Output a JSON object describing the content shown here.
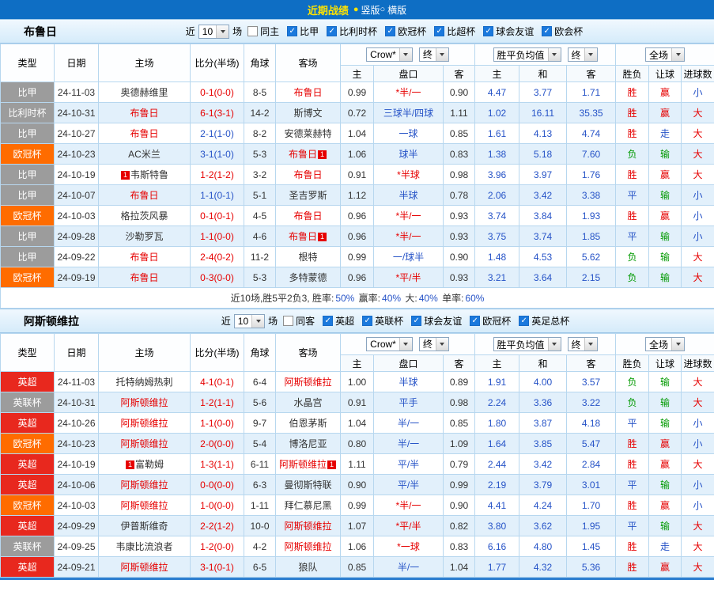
{
  "topbar": {
    "title": "近期战绩",
    "options": [
      {
        "label": "竖版",
        "selected": true
      },
      {
        "label": "横版",
        "selected": false
      }
    ]
  },
  "table_header": {
    "left_columns": [
      "类型",
      "日期",
      "主场",
      "比分(半场)",
      "角球",
      "客场"
    ],
    "group1_selects": [
      "Crow*",
      "终"
    ],
    "group2_selects": [
      "胜平负均值",
      "终"
    ],
    "group3_selects": [
      "全场"
    ],
    "sub_columns": [
      "主",
      "盘口",
      "客",
      "主",
      "和",
      "客",
      "胜负",
      "让球",
      "进球数"
    ]
  },
  "sections": [
    {
      "team": "布鲁日",
      "filter": {
        "near": "近",
        "count": "10",
        "games": "场",
        "same": "同主",
        "same_checked": false,
        "leagues": [
          {
            "label": "比甲",
            "checked": true
          },
          {
            "label": "比利时杯",
            "checked": true
          },
          {
            "label": "欧冠杯",
            "checked": true
          },
          {
            "label": "比超杯",
            "checked": true
          },
          {
            "label": "球会友谊",
            "checked": true
          },
          {
            "label": "欧会杯",
            "checked": true
          }
        ]
      },
      "rows": [
        {
          "type": "比甲",
          "type_style": "gray",
          "date": "24-11-03",
          "home": "奥德赫维里",
          "home_focus": false,
          "home_badge": false,
          "score": "0-1(0-0)",
          "score_color": "red",
          "corner": "8-5",
          "away": "布鲁日",
          "away_focus": true,
          "away_badge": false,
          "h_home": "0.99",
          "handicap": "*半/一",
          "handicap_color": "red",
          "h_away": "0.90",
          "e_home": "4.47",
          "e_draw": "3.77",
          "e_away": "1.71",
          "result": "胜",
          "result_color": "red",
          "cover": "赢",
          "cover_color": "red",
          "goals": "小",
          "goals_color": "blue"
        },
        {
          "type": "比利时杯",
          "type_style": "gray",
          "date": "24-10-31",
          "home": "布鲁日",
          "home_focus": true,
          "home_badge": false,
          "score": "6-1(3-1)",
          "score_color": "red",
          "corner": "14-2",
          "away": "斯博文",
          "away_focus": false,
          "away_badge": false,
          "h_home": "0.72",
          "handicap": "三球半/四球",
          "handicap_color": "blue",
          "h_away": "1.11",
          "e_home": "1.02",
          "e_draw": "16.11",
          "e_away": "35.35",
          "result": "胜",
          "result_color": "red",
          "cover": "赢",
          "cover_color": "red",
          "goals": "大",
          "goals_color": "red"
        },
        {
          "type": "比甲",
          "type_style": "gray",
          "date": "24-10-27",
          "home": "布鲁日",
          "home_focus": true,
          "home_badge": false,
          "score": "2-1(1-0)",
          "score_color": "blue",
          "corner": "8-2",
          "away": "安德莱赫特",
          "away_focus": false,
          "away_badge": false,
          "h_home": "1.04",
          "handicap": "一球",
          "handicap_color": "blue",
          "h_away": "0.85",
          "e_home": "1.61",
          "e_draw": "4.13",
          "e_away": "4.74",
          "result": "胜",
          "result_color": "red",
          "cover": "走",
          "cover_color": "blue",
          "goals": "大",
          "goals_color": "red"
        },
        {
          "type": "欧冠杯",
          "type_style": "orange",
          "date": "24-10-23",
          "home": "AC米兰",
          "home_focus": false,
          "home_badge": false,
          "score": "3-1(1-0)",
          "score_color": "blue",
          "corner": "5-3",
          "away": "布鲁日",
          "away_focus": true,
          "away_badge": true,
          "h_home": "1.06",
          "handicap": "球半",
          "handicap_color": "blue",
          "h_away": "0.83",
          "e_home": "1.38",
          "e_draw": "5.18",
          "e_away": "7.60",
          "result": "负",
          "result_color": "green",
          "cover": "输",
          "cover_color": "green",
          "goals": "大",
          "goals_color": "red"
        },
        {
          "type": "比甲",
          "type_style": "gray",
          "date": "24-10-19",
          "home": "韦斯特鲁",
          "home_focus": false,
          "home_badge": true,
          "score": "1-2(1-2)",
          "score_color": "red",
          "corner": "3-2",
          "away": "布鲁日",
          "away_focus": true,
          "away_badge": false,
          "h_home": "0.91",
          "handicap": "*半球",
          "handicap_color": "red",
          "h_away": "0.98",
          "e_home": "3.96",
          "e_draw": "3.97",
          "e_away": "1.76",
          "result": "胜",
          "result_color": "red",
          "cover": "赢",
          "cover_color": "red",
          "goals": "大",
          "goals_color": "red"
        },
        {
          "type": "比甲",
          "type_style": "gray",
          "date": "24-10-07",
          "home": "布鲁日",
          "home_focus": true,
          "home_badge": false,
          "score": "1-1(0-1)",
          "score_color": "blue",
          "corner": "5-1",
          "away": "圣吉罗斯",
          "away_focus": false,
          "away_badge": false,
          "h_home": "1.12",
          "handicap": "半球",
          "handicap_color": "blue",
          "h_away": "0.78",
          "e_home": "2.06",
          "e_draw": "3.42",
          "e_away": "3.38",
          "result": "平",
          "result_color": "blue",
          "cover": "输",
          "cover_color": "green",
          "goals": "小",
          "goals_color": "blue"
        },
        {
          "type": "欧冠杯",
          "type_style": "orange",
          "date": "24-10-03",
          "home": "格拉茨风暴",
          "home_focus": false,
          "home_badge": false,
          "score": "0-1(0-1)",
          "score_color": "red",
          "corner": "4-5",
          "away": "布鲁日",
          "away_focus": true,
          "away_badge": false,
          "h_home": "0.96",
          "handicap": "*半/一",
          "handicap_color": "red",
          "h_away": "0.93",
          "e_home": "3.74",
          "e_draw": "3.84",
          "e_away": "1.93",
          "result": "胜",
          "result_color": "red",
          "cover": "赢",
          "cover_color": "red",
          "goals": "小",
          "goals_color": "blue"
        },
        {
          "type": "比甲",
          "type_style": "gray",
          "date": "24-09-28",
          "home": "沙勒罗瓦",
          "home_focus": false,
          "home_badge": false,
          "score": "1-1(0-0)",
          "score_color": "red",
          "corner": "4-6",
          "away": "布鲁日",
          "away_focus": true,
          "away_badge": true,
          "h_home": "0.96",
          "handicap": "*半/一",
          "handicap_color": "red",
          "h_away": "0.93",
          "e_home": "3.75",
          "e_draw": "3.74",
          "e_away": "1.85",
          "result": "平",
          "result_color": "blue",
          "cover": "输",
          "cover_color": "green",
          "goals": "小",
          "goals_color": "blue"
        },
        {
          "type": "比甲",
          "type_style": "gray",
          "date": "24-09-22",
          "home": "布鲁日",
          "home_focus": true,
          "home_badge": false,
          "score": "2-4(0-2)",
          "score_color": "red",
          "corner": "11-2",
          "away": "根特",
          "away_focus": false,
          "away_badge": false,
          "h_home": "0.99",
          "handicap": "一/球半",
          "handicap_color": "blue",
          "h_away": "0.90",
          "e_home": "1.48",
          "e_draw": "4.53",
          "e_away": "5.62",
          "result": "负",
          "result_color": "green",
          "cover": "输",
          "cover_color": "green",
          "goals": "大",
          "goals_color": "red"
        },
        {
          "type": "欧冠杯",
          "type_style": "orange",
          "date": "24-09-19",
          "home": "布鲁日",
          "home_focus": true,
          "home_badge": false,
          "score": "0-3(0-0)",
          "score_color": "red",
          "corner": "5-3",
          "away": "多特蒙德",
          "away_focus": false,
          "away_badge": false,
          "h_home": "0.96",
          "handicap": "*平/半",
          "handicap_color": "red",
          "h_away": "0.93",
          "e_home": "3.21",
          "e_draw": "3.64",
          "e_away": "2.15",
          "result": "负",
          "result_color": "green",
          "cover": "输",
          "cover_color": "green",
          "goals": "大",
          "goals_color": "red"
        }
      ],
      "summary": [
        {
          "text": "近10场,胜5平2负3, 胜率:",
          "color": "black"
        },
        {
          "text": "50%",
          "color": "blue"
        },
        {
          "text": " 赢率:",
          "color": "black"
        },
        {
          "text": "40%",
          "color": "blue"
        },
        {
          "text": " 大:",
          "color": "black"
        },
        {
          "text": "40%",
          "color": "blue"
        },
        {
          "text": " 单率:",
          "color": "black"
        },
        {
          "text": "60%",
          "color": "blue"
        }
      ]
    },
    {
      "team": "阿斯顿维拉",
      "filter": {
        "near": "近",
        "count": "10",
        "games": "场",
        "same": "同客",
        "same_checked": false,
        "leagues": [
          {
            "label": "英超",
            "checked": true
          },
          {
            "label": "英联杯",
            "checked": true
          },
          {
            "label": "球会友谊",
            "checked": true
          },
          {
            "label": "欧冠杯",
            "checked": true
          },
          {
            "label": "英足总杯",
            "checked": true
          }
        ]
      },
      "rows": [
        {
          "type": "英超",
          "type_style": "red",
          "date": "24-11-03",
          "home": "托特纳姆热刺",
          "home_focus": false,
          "home_badge": false,
          "score": "4-1(0-1)",
          "score_color": "red",
          "corner": "6-4",
          "away": "阿斯顿维拉",
          "away_focus": true,
          "away_badge": false,
          "h_home": "1.00",
          "handicap": "半球",
          "handicap_color": "blue",
          "h_away": "0.89",
          "e_home": "1.91",
          "e_draw": "4.00",
          "e_away": "3.57",
          "result": "负",
          "result_color": "green",
          "cover": "输",
          "cover_color": "green",
          "goals": "大",
          "goals_color": "red"
        },
        {
          "type": "英联杯",
          "type_style": "gray",
          "date": "24-10-31",
          "home": "阿斯顿维拉",
          "home_focus": true,
          "home_badge": false,
          "score": "1-2(1-1)",
          "score_color": "red",
          "corner": "5-6",
          "away": "水晶宫",
          "away_focus": false,
          "away_badge": false,
          "h_home": "0.91",
          "handicap": "平手",
          "handicap_color": "blue",
          "h_away": "0.98",
          "e_home": "2.24",
          "e_draw": "3.36",
          "e_away": "3.22",
          "result": "负",
          "result_color": "green",
          "cover": "输",
          "cover_color": "green",
          "goals": "大",
          "goals_color": "red"
        },
        {
          "type": "英超",
          "type_style": "red",
          "date": "24-10-26",
          "home": "阿斯顿维拉",
          "home_focus": true,
          "home_badge": false,
          "score": "1-1(0-0)",
          "score_color": "red",
          "corner": "9-7",
          "away": "伯恩茅斯",
          "away_focus": false,
          "away_badge": false,
          "h_home": "1.04",
          "handicap": "半/一",
          "handicap_color": "blue",
          "h_away": "0.85",
          "e_home": "1.80",
          "e_draw": "3.87",
          "e_away": "4.18",
          "result": "平",
          "result_color": "blue",
          "cover": "输",
          "cover_color": "green",
          "goals": "小",
          "goals_color": "blue"
        },
        {
          "type": "欧冠杯",
          "type_style": "orange",
          "date": "24-10-23",
          "home": "阿斯顿维拉",
          "home_focus": true,
          "home_badge": false,
          "score": "2-0(0-0)",
          "score_color": "red",
          "corner": "5-4",
          "away": "博洛尼亚",
          "away_focus": false,
          "away_badge": false,
          "h_home": "0.80",
          "handicap": "半/一",
          "handicap_color": "blue",
          "h_away": "1.09",
          "e_home": "1.64",
          "e_draw": "3.85",
          "e_away": "5.47",
          "result": "胜",
          "result_color": "red",
          "cover": "赢",
          "cover_color": "red",
          "goals": "小",
          "goals_color": "blue"
        },
        {
          "type": "英超",
          "type_style": "red",
          "date": "24-10-19",
          "home": "富勒姆",
          "home_focus": false,
          "home_badge": true,
          "score": "1-3(1-1)",
          "score_color": "red",
          "corner": "6-11",
          "away": "阿斯顿维拉",
          "away_focus": true,
          "away_badge": true,
          "h_home": "1.11",
          "handicap": "平/半",
          "handicap_color": "blue",
          "h_away": "0.79",
          "e_home": "2.44",
          "e_draw": "3.42",
          "e_away": "2.84",
          "result": "胜",
          "result_color": "red",
          "cover": "赢",
          "cover_color": "red",
          "goals": "大",
          "goals_color": "red"
        },
        {
          "type": "英超",
          "type_style": "red",
          "date": "24-10-06",
          "home": "阿斯顿维拉",
          "home_focus": true,
          "home_badge": false,
          "score": "0-0(0-0)",
          "score_color": "red",
          "corner": "6-3",
          "away": "曼彻斯特联",
          "away_focus": false,
          "away_badge": false,
          "h_home": "0.90",
          "handicap": "平/半",
          "handicap_color": "blue",
          "h_away": "0.99",
          "e_home": "2.19",
          "e_draw": "3.79",
          "e_away": "3.01",
          "result": "平",
          "result_color": "blue",
          "cover": "输",
          "cover_color": "green",
          "goals": "小",
          "goals_color": "blue"
        },
        {
          "type": "欧冠杯",
          "type_style": "orange",
          "date": "24-10-03",
          "home": "阿斯顿维拉",
          "home_focus": true,
          "home_badge": false,
          "score": "1-0(0-0)",
          "score_color": "red",
          "corner": "1-11",
          "away": "拜仁慕尼黑",
          "away_focus": false,
          "away_badge": false,
          "h_home": "0.99",
          "handicap": "*半/一",
          "handicap_color": "red",
          "h_away": "0.90",
          "e_home": "4.41",
          "e_draw": "4.24",
          "e_away": "1.70",
          "result": "胜",
          "result_color": "red",
          "cover": "赢",
          "cover_color": "red",
          "goals": "小",
          "goals_color": "blue"
        },
        {
          "type": "英超",
          "type_style": "red",
          "date": "24-09-29",
          "home": "伊普斯维奇",
          "home_focus": false,
          "home_badge": false,
          "score": "2-2(1-2)",
          "score_color": "red",
          "corner": "10-0",
          "away": "阿斯顿维拉",
          "away_focus": true,
          "away_badge": false,
          "h_home": "1.07",
          "handicap": "*平/半",
          "handicap_color": "red",
          "h_away": "0.82",
          "e_home": "3.80",
          "e_draw": "3.62",
          "e_away": "1.95",
          "result": "平",
          "result_color": "blue",
          "cover": "输",
          "cover_color": "green",
          "goals": "大",
          "goals_color": "red"
        },
        {
          "type": "英联杯",
          "type_style": "gray",
          "date": "24-09-25",
          "home": "韦康比流浪者",
          "home_focus": false,
          "home_badge": false,
          "score": "1-2(0-0)",
          "score_color": "red",
          "corner": "4-2",
          "away": "阿斯顿维拉",
          "away_focus": true,
          "away_badge": false,
          "h_home": "1.06",
          "handicap": "*一球",
          "handicap_color": "red",
          "h_away": "0.83",
          "e_home": "6.16",
          "e_draw": "4.80",
          "e_away": "1.45",
          "result": "胜",
          "result_color": "red",
          "cover": "走",
          "cover_color": "blue",
          "goals": "大",
          "goals_color": "red"
        },
        {
          "type": "英超",
          "type_style": "red",
          "date": "24-09-21",
          "home": "阿斯顿维拉",
          "home_focus": true,
          "home_badge": false,
          "score": "3-1(0-1)",
          "score_color": "red",
          "corner": "6-5",
          "away": "狼队",
          "away_focus": false,
          "away_badge": false,
          "h_home": "0.85",
          "handicap": "半/一",
          "handicap_color": "blue",
          "h_away": "1.04",
          "e_home": "1.77",
          "e_draw": "4.32",
          "e_away": "5.36",
          "result": "胜",
          "result_color": "red",
          "cover": "赢",
          "cover_color": "red",
          "goals": "大",
          "goals_color": "red"
        }
      ],
      "summary": null
    }
  ],
  "colors": {
    "topbar_bg": "#0E6EC4",
    "title_yellow": "#FFE400",
    "accent_red": "#E60000",
    "accent_blue": "#2653C7",
    "accent_green": "#009900",
    "league_gray": "#9C9C9C",
    "league_orange": "#FF6C00",
    "league_red": "#E8281E",
    "row_alt": "#E2F0FB",
    "grid_line": "#B7D7EF"
  }
}
